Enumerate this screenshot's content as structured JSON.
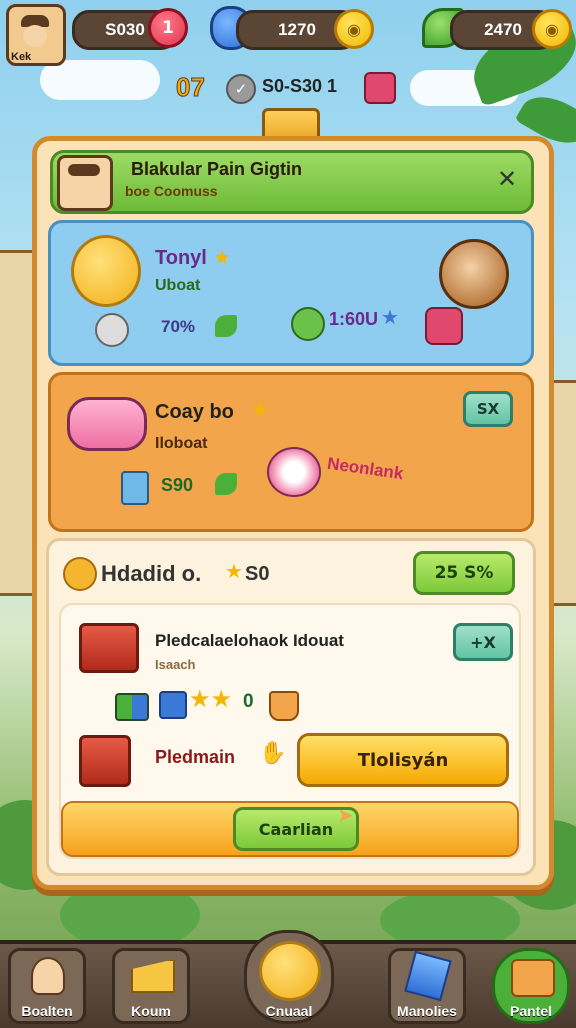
{
  "hud": {
    "player_badge": "Kek",
    "currency_1": "S030",
    "currency_1_plus": "1",
    "currency_2": "1270",
    "currency_3": "2470"
  },
  "subbar": {
    "level": "07",
    "range": "S0-S30 1"
  },
  "panel": {
    "header_title": "Blakular Pain Gigtin",
    "header_subtitle": "boe Coomuss"
  },
  "card1": {
    "title": "Tonyl",
    "subtitle": "Uboat",
    "percent": "70%",
    "timer": "1:60U"
  },
  "card2": {
    "title": "Coay bo",
    "subtitle": "Iloboat",
    "price": "S90",
    "tag": "Neonlank",
    "close_label": "SX"
  },
  "card3": {
    "title": "Hdadid o.",
    "title_value": "S0",
    "badge": "25 S%",
    "inner_title": "Pledcalaelohaok Idouat",
    "inner_subtitle": "Isaach",
    "inner_close": "+X",
    "reward_count": "0",
    "reward2_label": "Pledmain",
    "reward2_button": "Tlolisyán",
    "wide_button": "Caarlian"
  },
  "nav": [
    {
      "label": "Boalten"
    },
    {
      "label": "Koum"
    },
    {
      "label": "Cnuaal"
    },
    {
      "label": "Manolies"
    },
    {
      "label": "Pantel"
    }
  ],
  "colors": {
    "panel_border": "#d38a2e",
    "card_blue": "#8fcdf0",
    "card_orange": "#f2a54a",
    "accent_green": "#7cc93a"
  }
}
